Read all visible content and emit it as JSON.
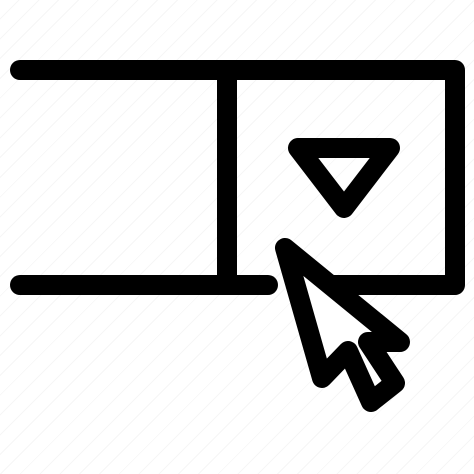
{
  "icon": {
    "name": "dropdown-select-click-icon",
    "stroke_color": "#000000",
    "fill_color": "#ffffff",
    "parts": {
      "field": "dropdown-field-icon",
      "arrow": "triangle-down-icon",
      "cursor": "mouse-pointer-icon"
    }
  }
}
